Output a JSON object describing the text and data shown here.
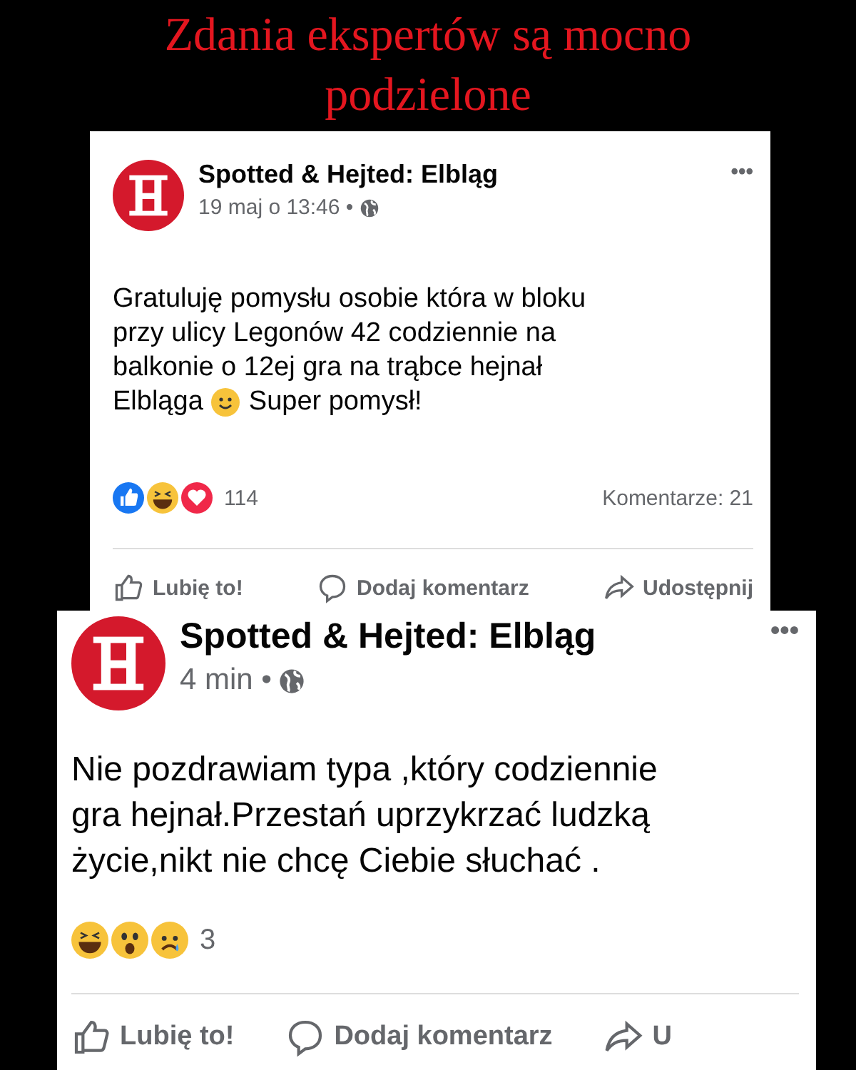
{
  "headline": [
    "Zdania ekspertów są mocno",
    "podzielone"
  ],
  "posts": [
    {
      "page_name": "Spotted & Hejted: Elbląg",
      "time": "19 maj o 13:46 •",
      "text_lines": [
        "Gratuluję pomysłu osobie która w bloku",
        "przy ulicy Legonów 42 codziennie na",
        "balkonie o 12ej gra na trąbce hejnał"
      ],
      "last_line": [
        "Elbląga",
        "Super pomysł!"
      ],
      "reactions": [
        {
          "kind": "like"
        },
        {
          "kind": "haha"
        },
        {
          "kind": "love"
        }
      ],
      "reaction_count": "114",
      "comments": "Komentarze: 21",
      "menu": "•••",
      "actions": [
        {
          "kind": "like",
          "label": "Lubię to!"
        },
        {
          "kind": "comment",
          "label": "Dodaj komentarz"
        },
        {
          "kind": "share",
          "label": "Udostępnij"
        }
      ]
    },
    {
      "page_name": "Spotted & Hejted: Elbląg",
      "time": "4 min •",
      "text_lines": [
        "Nie pozdrawiam typa ,który codziennie",
        "gra hejnał.Przestań uprzykrzać ludzką",
        "życie,nikt nie chcę Ciebie słuchać ."
      ],
      "reactions": [
        {
          "kind": "haha"
        },
        {
          "kind": "wow"
        },
        {
          "kind": "sad"
        }
      ],
      "reaction_count": "3",
      "menu": "•••",
      "actions": [
        {
          "kind": "like",
          "label": "Lubię to!"
        },
        {
          "kind": "comment",
          "label": "Dodaj komentarz"
        },
        {
          "kind": "share",
          "label": "U"
        }
      ]
    }
  ]
}
